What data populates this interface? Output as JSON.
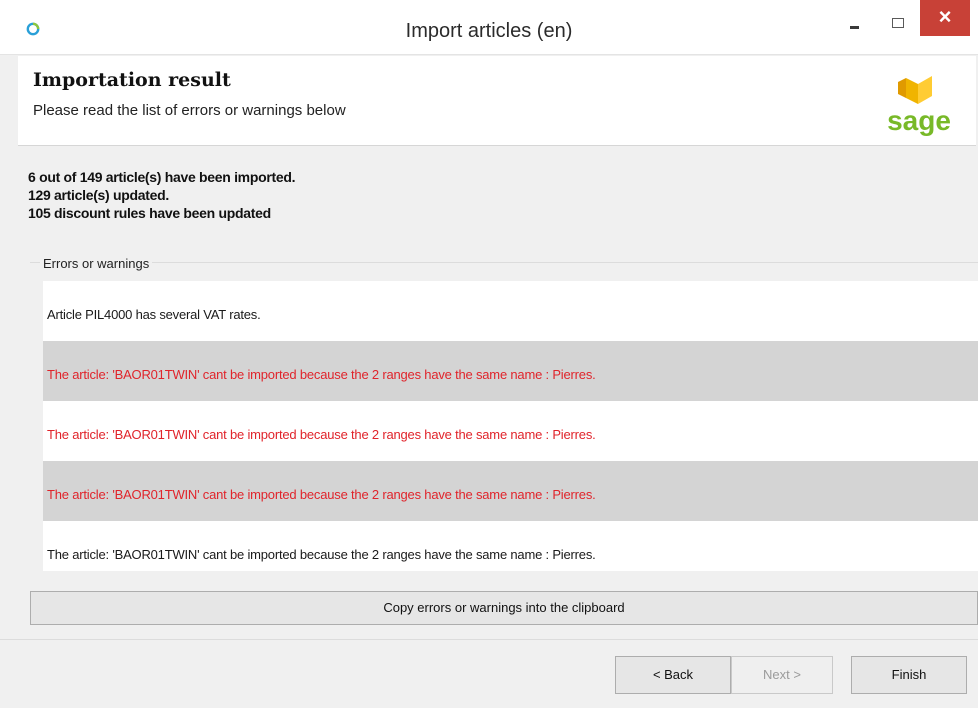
{
  "window": {
    "title": "Import articles (en)",
    "controls": {
      "minimize": "minimize",
      "maximize": "maximize",
      "close": "×"
    }
  },
  "header": {
    "title": "Importation result",
    "subtitle": "Please read the list of errors or warnings below",
    "logo_text": "sage"
  },
  "summary": {
    "line1": "6 out of 149 article(s) have been imported.",
    "line2": "129 article(s) updated.",
    "line3": "105 discount rules have been updated"
  },
  "messages": {
    "group_label": "Errors or warnings",
    "items": [
      {
        "text": "Article PIL4000 has several VAT rates.",
        "type": "warning"
      },
      {
        "text": "The article: 'BAOR01TWIN' cant be imported because the 2 ranges have the same name : Pierres.",
        "type": "error"
      },
      {
        "text": "The article: 'BAOR01TWIN' cant be imported because the 2 ranges have the same name : Pierres.",
        "type": "error"
      },
      {
        "text": "The article: 'BAOR01TWIN' cant be imported because the 2 ranges have the same name : Pierres.",
        "type": "error"
      },
      {
        "text": "The article: 'BAOR01TWIN' cant be imported because the 2 ranges have the same name : Pierres.",
        "type": "warning"
      }
    ]
  },
  "buttons": {
    "copy": "Copy errors or warnings into the clipboard",
    "back": "< Back",
    "next": "Next >",
    "finish": "Finish"
  },
  "colors": {
    "error_text": "#e0242b",
    "close_button": "#c84137",
    "sage_green": "#78b928",
    "sage_yellow": "#f0b400"
  }
}
